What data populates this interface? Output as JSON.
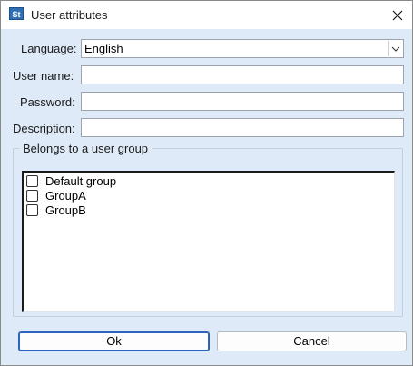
{
  "window": {
    "title": "User attributes",
    "app_icon_text": "St"
  },
  "form": {
    "language_label": "Language:",
    "language_value": "English",
    "username_label": "User name:",
    "username_value": "",
    "password_label": "Password:",
    "password_value": "",
    "description_label": "Description:",
    "description_value": ""
  },
  "groups": {
    "legend": "Belongs to a user group",
    "items": [
      {
        "label": "Default group",
        "checked": false
      },
      {
        "label": "GroupA",
        "checked": false
      },
      {
        "label": "GroupB",
        "checked": false
      }
    ]
  },
  "buttons": {
    "ok_label": "Ok",
    "cancel_label": "Cancel"
  },
  "icons": {
    "app": "app-icon",
    "close": "close-icon",
    "dropdown": "chevron-down-icon"
  },
  "colors": {
    "dialog_background": "#dfeaf8",
    "default_button_border": "#2b63c2"
  }
}
